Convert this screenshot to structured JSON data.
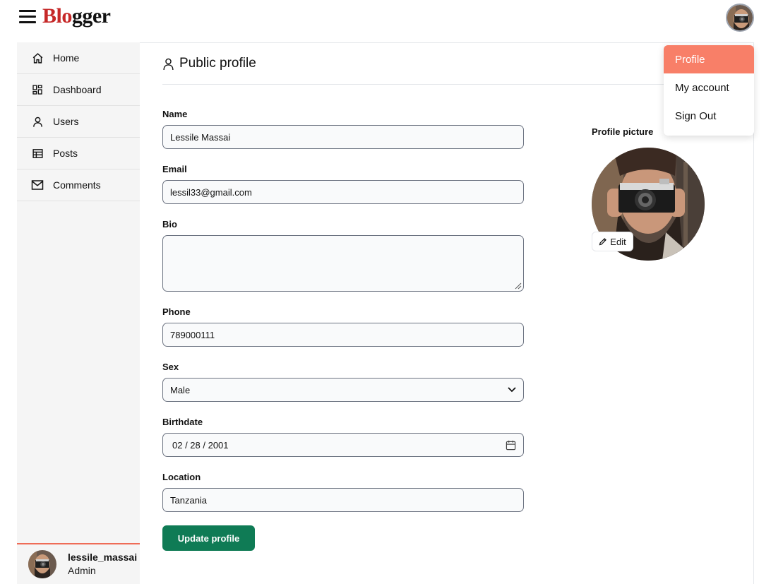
{
  "header": {
    "brand_part1": "Blo",
    "brand_part2": "gger",
    "menu_icon": "hamburger-icon"
  },
  "sidebar": {
    "items": [
      {
        "label": "Home",
        "icon": "home-icon"
      },
      {
        "label": "Dashboard",
        "icon": "dashboard-icon"
      },
      {
        "label": "Users",
        "icon": "user-icon"
      },
      {
        "label": "Posts",
        "icon": "table-icon"
      },
      {
        "label": "Comments",
        "icon": "mail-icon"
      }
    ],
    "footer": {
      "username": "lessile_massai",
      "role": "Admin"
    }
  },
  "main": {
    "title": "Public profile",
    "form": {
      "name": {
        "label": "Name",
        "value": "Lessile Massai"
      },
      "email": {
        "label": "Email",
        "value": "lessil33@gmail.com"
      },
      "bio": {
        "label": "Bio",
        "value": ""
      },
      "phone": {
        "label": "Phone",
        "value": "789000111"
      },
      "sex": {
        "label": "Sex",
        "value": "Male"
      },
      "birthdate": {
        "label": "Birthdate",
        "value": "02 / 28 / 2001"
      },
      "location": {
        "label": "Location",
        "value": "Tanzania"
      },
      "submit_label": "Update profile"
    },
    "profile_picture": {
      "label": "Profile picture",
      "edit_label": "Edit"
    }
  },
  "dropdown": {
    "items": [
      {
        "label": "Profile",
        "active": true
      },
      {
        "label": "My account",
        "active": false
      },
      {
        "label": "Sign Out",
        "active": false
      }
    ]
  },
  "colors": {
    "brand_red": "#c62828",
    "primary_green": "#0f7b55",
    "active_menu": "#f87f68",
    "sidebar_bg": "#f5f5f5",
    "footer_accent": "#ef6c57"
  }
}
